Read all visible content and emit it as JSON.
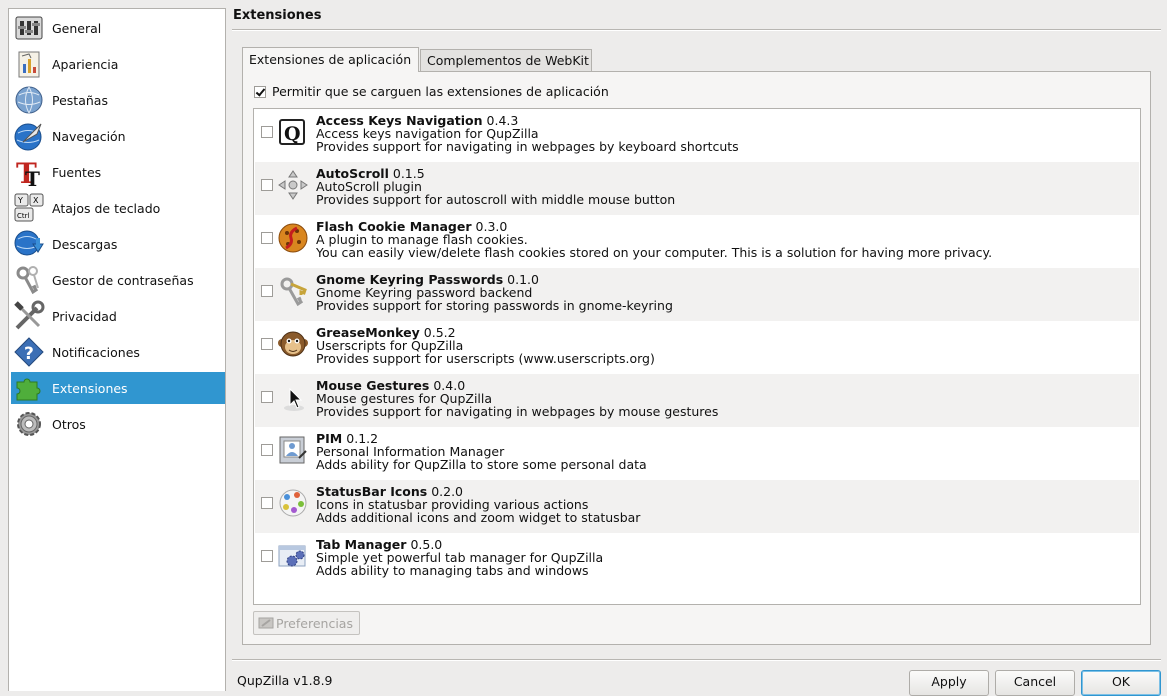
{
  "sidebar": {
    "items": [
      {
        "label": "General",
        "icon": "general-icon"
      },
      {
        "label": "Apariencia",
        "icon": "appearance-icon"
      },
      {
        "label": "Pestañas",
        "icon": "tabs-globe-icon"
      },
      {
        "label": "Navegación",
        "icon": "navigation-globe-icon"
      },
      {
        "label": "Fuentes",
        "icon": "fonts-icon"
      },
      {
        "label": "Atajos de teclado",
        "icon": "keyboard-shortcuts-icon"
      },
      {
        "label": "Descargas",
        "icon": "downloads-icon"
      },
      {
        "label": "Gestor de contraseñas",
        "icon": "passwords-keys-icon"
      },
      {
        "label": "Privacidad",
        "icon": "privacy-tools-icon"
      },
      {
        "label": "Notificaciones",
        "icon": "notifications-help-icon"
      },
      {
        "label": "Extensiones",
        "icon": "extensions-puzzle-icon",
        "selected": true
      },
      {
        "label": "Otros",
        "icon": "other-gear-icon"
      }
    ]
  },
  "page": {
    "title": "Extensiones",
    "tabs": [
      {
        "label": "Extensiones de aplicación",
        "active": true
      },
      {
        "label": "Complementos de WebKit",
        "active": false
      }
    ],
    "allow_label": "Permitir que se carguen las extensiones de aplicación",
    "allow_checked": true,
    "preferences_label": "Preferencias"
  },
  "plugins": [
    {
      "name": "Access Keys Navigation",
      "version": "0.4.3",
      "summary": "Access keys navigation for QupZilla",
      "description": "Provides support for navigating in webpages by keyboard shortcuts",
      "icon": "access-keys-icon",
      "enabled": false
    },
    {
      "name": "AutoScroll",
      "version": "0.1.5",
      "summary": "AutoScroll plugin",
      "description": "Provides support for autoscroll with middle mouse button",
      "icon": "autoscroll-icon",
      "enabled": false
    },
    {
      "name": "Flash Cookie Manager",
      "version": "0.3.0",
      "summary": "A plugin to manage flash cookies.",
      "description": "You can easily view/delete flash cookies stored on your computer. This is a solution for having more privacy.",
      "icon": "flash-cookie-icon",
      "enabled": false
    },
    {
      "name": "Gnome Keyring Passwords",
      "version": "0.1.0",
      "summary": "Gnome Keyring password backend",
      "description": "Provides support for storing passwords in gnome-keyring",
      "icon": "keyring-icon",
      "enabled": false
    },
    {
      "name": "GreaseMonkey",
      "version": "0.5.2",
      "summary": "Userscripts for QupZilla",
      "description": "Provides support for userscripts (www.userscripts.org)",
      "icon": "greasemonkey-icon",
      "enabled": false
    },
    {
      "name": "Mouse Gestures",
      "version": "0.4.0",
      "summary": "Mouse gestures for QupZilla",
      "description": "Provides support for navigating in webpages by mouse gestures",
      "icon": "mouse-gestures-icon",
      "enabled": false
    },
    {
      "name": "PIM",
      "version": "0.1.2",
      "summary": "Personal Information Manager",
      "description": "Adds ability for QupZilla to store some personal data",
      "icon": "pim-icon",
      "enabled": false
    },
    {
      "name": "StatusBar Icons",
      "version": "0.2.0",
      "summary": "Icons in statusbar providing various actions",
      "description": "Adds additional icons and zoom widget to statusbar",
      "icon": "statusbar-icons-icon",
      "enabled": false
    },
    {
      "name": "Tab Manager",
      "version": "0.5.0",
      "summary": "Simple yet powerful tab manager for QupZilla",
      "description": "Adds ability to managing tabs and windows",
      "icon": "tab-manager-icon",
      "enabled": false
    }
  ],
  "footer": {
    "version": "QupZilla v1.8.9",
    "apply_label": "Apply",
    "cancel_label": "Cancel",
    "ok_label": "OK"
  },
  "colors": {
    "selection": "#3096d0",
    "window_bg": "#edeceb",
    "alt_row": "#f2f1f0"
  }
}
